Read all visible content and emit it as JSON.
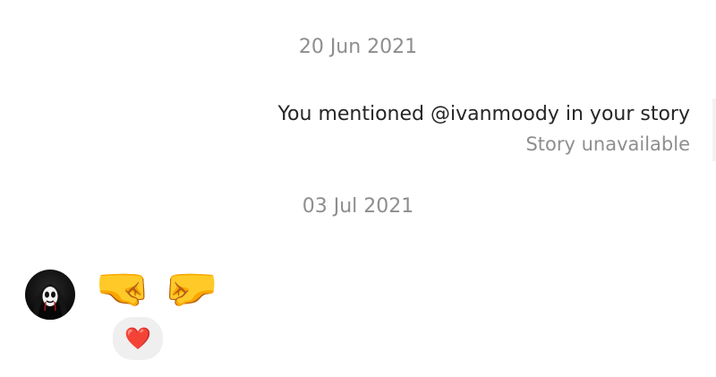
{
  "thread": {
    "dates": [
      "20 Jun 2021",
      "03 Jul 2021"
    ],
    "story_mention": {
      "text": "You mentioned @ivanmoody in your story",
      "status": "Story unavailable"
    },
    "incoming_message": {
      "emojis": [
        "🤜",
        "🤛"
      ],
      "reaction": "❤️"
    },
    "avatar": {
      "icon": "masked-figure-avatar"
    }
  }
}
